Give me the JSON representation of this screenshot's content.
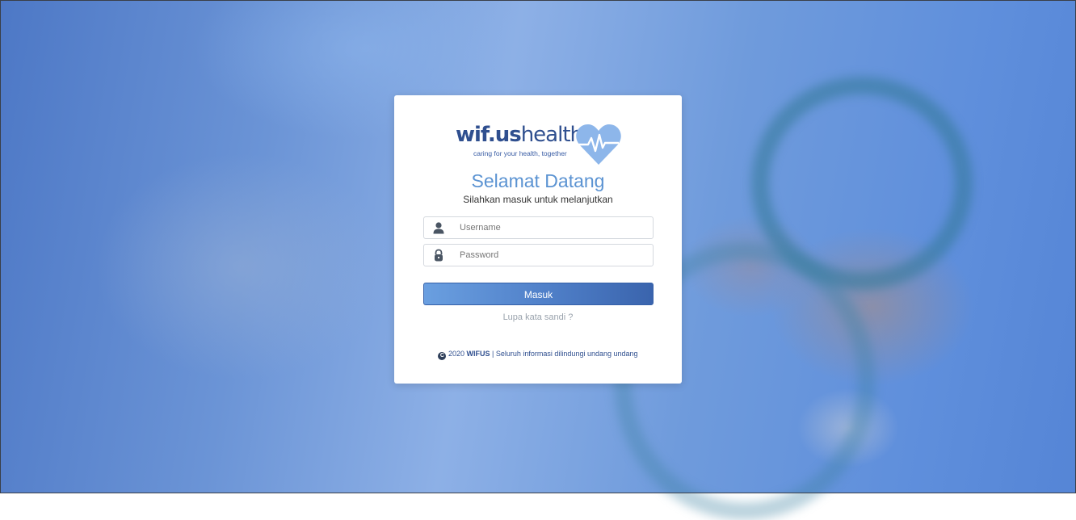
{
  "brand": {
    "name_bold": "wif.us",
    "name_light": "health",
    "tagline": "caring for your health, together"
  },
  "login": {
    "title": "Selamat Datang",
    "subtitle": "Silahkan masuk untuk melanjutkan",
    "username_placeholder": "Username",
    "password_placeholder": "Password",
    "submit_label": "Masuk",
    "forgot_label": "Lupa kata sandi ?"
  },
  "footer": {
    "copyright_symbol": "C",
    "year": "2020",
    "company": "WIFUS",
    "separator": "|",
    "notice": "Seluruh informasi dilindungi undang undang"
  },
  "icons": {
    "username": "user-icon",
    "password": "lock-icon",
    "copyright": "copyright-icon",
    "logo": "heart-pulse-icon"
  },
  "colors": {
    "accent": "#5b93d2",
    "brand_dark": "#2f4f8f",
    "button_start": "#6a9fe0",
    "button_end": "#3a64ad"
  }
}
